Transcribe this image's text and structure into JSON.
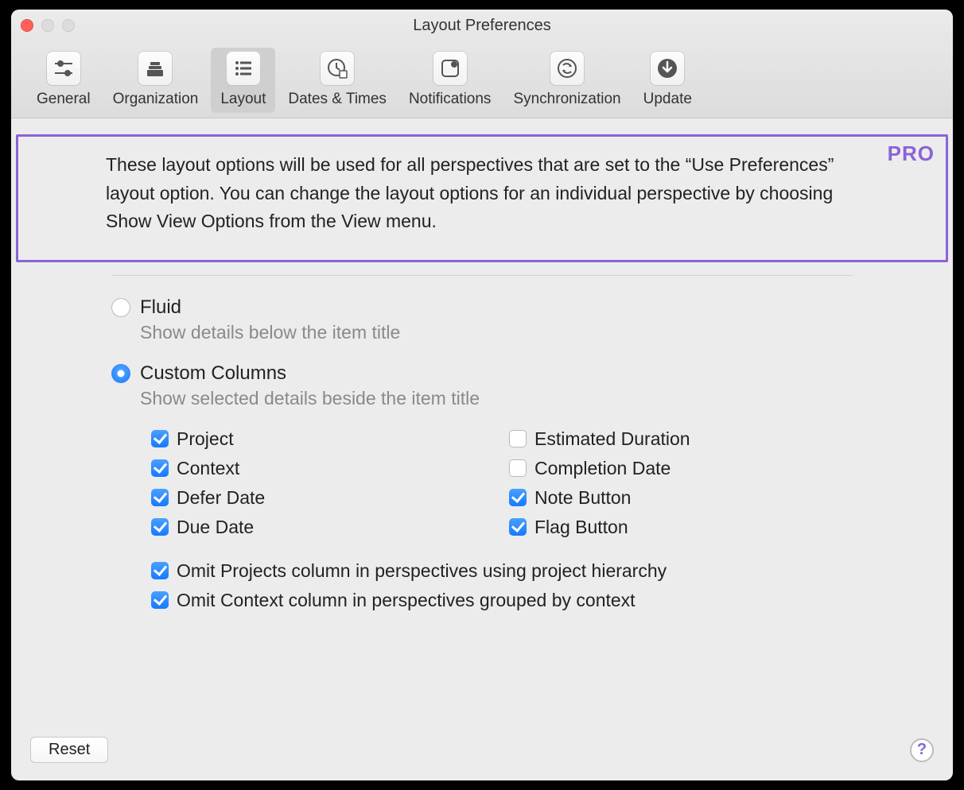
{
  "window": {
    "title": "Layout Preferences"
  },
  "toolbar": {
    "tabs": [
      {
        "label": "General"
      },
      {
        "label": "Organization"
      },
      {
        "label": "Layout"
      },
      {
        "label": "Dates & Times"
      },
      {
        "label": "Notifications"
      },
      {
        "label": "Synchronization"
      },
      {
        "label": "Update"
      }
    ],
    "selected_index": 2
  },
  "highlight": {
    "badge": "PRO",
    "text": "These layout options will be used for all perspectives that are set to the “Use Preferences” layout option. You can change the layout options for an individual perspective by choosing Show View Options from the View menu."
  },
  "radios": {
    "fluid": {
      "label": "Fluid",
      "sub": "Show details below the item title",
      "checked": false
    },
    "custom": {
      "label": "Custom Columns",
      "sub": "Show selected details beside the item title",
      "checked": true
    }
  },
  "columns": {
    "left": [
      {
        "label": "Project",
        "checked": true
      },
      {
        "label": "Context",
        "checked": true
      },
      {
        "label": "Defer Date",
        "checked": true
      },
      {
        "label": "Due Date",
        "checked": true
      }
    ],
    "right": [
      {
        "label": "Estimated Duration",
        "checked": false
      },
      {
        "label": "Completion Date",
        "checked": false
      },
      {
        "label": "Note Button",
        "checked": true
      },
      {
        "label": "Flag Button",
        "checked": true
      }
    ]
  },
  "omit": [
    {
      "label": "Omit Projects column in perspectives using project hierarchy",
      "checked": true
    },
    {
      "label": "Omit Context column in perspectives grouped by context",
      "checked": true
    }
  ],
  "footer": {
    "reset": "Reset",
    "help": "?"
  }
}
